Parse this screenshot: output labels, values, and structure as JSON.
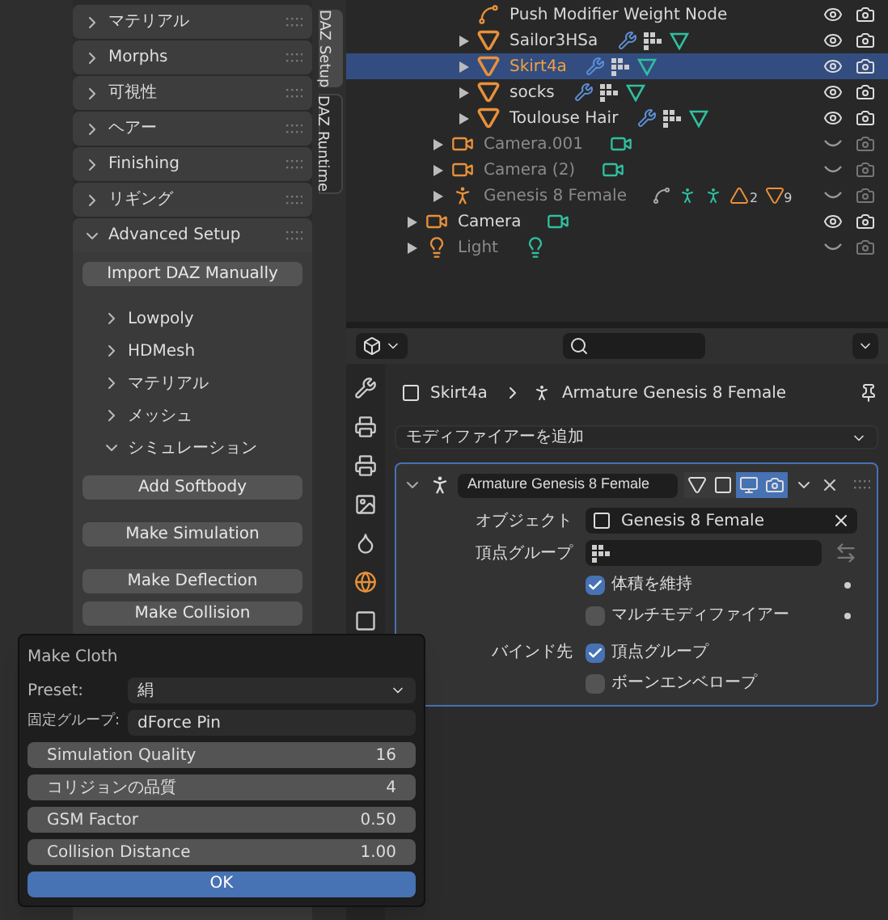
{
  "side_panel": {
    "sections": [
      {
        "label": "マテリアル",
        "expanded": false
      },
      {
        "label": "Morphs",
        "expanded": false
      },
      {
        "label": "可視性",
        "expanded": false
      },
      {
        "label": "ヘアー",
        "expanded": false
      },
      {
        "label": "Finishing",
        "expanded": false
      },
      {
        "label": "リギング",
        "expanded": false
      },
      {
        "label": "Advanced Setup",
        "expanded": true
      }
    ],
    "import_button": "Import DAZ Manually",
    "subsections": [
      {
        "label": "Lowpoly",
        "expanded": false
      },
      {
        "label": "HDMesh",
        "expanded": false
      },
      {
        "label": "マテリアル",
        "expanded": false
      },
      {
        "label": "メッシュ",
        "expanded": false
      },
      {
        "label": "シミュレーション",
        "expanded": true
      }
    ],
    "button_groups": [
      [
        "Add Softbody"
      ],
      [
        "Make Simulation"
      ],
      [
        "Make Deflection",
        "Make Collision"
      ]
    ]
  },
  "tabs": [
    {
      "label": "DAZ Setup",
      "selected": true
    },
    {
      "label": "DAZ Runtime",
      "selected": false
    }
  ],
  "outliner": {
    "items": [
      {
        "children": [
          {
            "children": [
              {
                "name": "Push Modifier Weight Node",
                "kind": "node",
                "selected": false,
                "dimmed": false,
                "visible": true
              },
              {
                "name": "Sailor3HSa",
                "kind": "mesh",
                "selected": false,
                "dimmed": false,
                "visible": true
              },
              {
                "name": "Skirt4a",
                "kind": "mesh",
                "selected": true,
                "dimmed": false,
                "visible": true
              },
              {
                "name": "socks",
                "kind": "mesh",
                "selected": false,
                "dimmed": false,
                "visible": true
              },
              {
                "name": "Toulouse Hair",
                "kind": "mesh",
                "selected": false,
                "dimmed": false,
                "visible": true
              }
            ]
          },
          {
            "name": "Camera.001",
            "kind": "camera",
            "selected": false,
            "dimmed": true,
            "visible": false
          },
          {
            "name": "Camera (2)",
            "kind": "camera",
            "selected": false,
            "dimmed": true,
            "visible": false
          },
          {
            "name": "Genesis 8 Female",
            "kind": "armature",
            "selected": false,
            "dimmed": true,
            "visible": false,
            "counts": [
              "2",
              "9"
            ]
          }
        ]
      },
      {
        "name": "Camera",
        "kind": "camera",
        "selected": false,
        "dimmed": false,
        "visible": true
      },
      {
        "name": "Light",
        "kind": "light",
        "selected": false,
        "dimmed": true,
        "visible": false
      }
    ]
  },
  "properties": {
    "breadcrumb": [
      "Skirt4a",
      "Armature Genesis 8 Female"
    ],
    "add_modifier": "モディファイアーを追加",
    "modifier": {
      "name": "Armature Genesis 8 Female",
      "expanded": true,
      "toggles": [
        {
          "kind": "cage",
          "on": false
        },
        {
          "kind": "editmode",
          "on": false
        },
        {
          "kind": "viewport",
          "on": true
        },
        {
          "kind": "render",
          "on": true
        }
      ],
      "object_label": "オブジェクト",
      "object": "Genesis 8 Female",
      "vertex_group_label": "頂点グループ",
      "options": [
        {
          "label": "体積を維持",
          "checked": true
        },
        {
          "label": "マルチモディファイアー",
          "checked": false
        }
      ],
      "bind_label": "バインド先",
      "bind": [
        {
          "label": "頂点グループ",
          "checked": true
        },
        {
          "label": "ボーンエンベロープ",
          "checked": false
        }
      ]
    }
  },
  "dialog": {
    "title": "Make Cloth",
    "preset_label": "Preset:",
    "preset": "絹",
    "pin_label": "固定グループ:",
    "pin_group": "dForce Pin",
    "fields": [
      {
        "label": "Simulation Quality",
        "value": "16"
      },
      {
        "label": "コリジョンの品質",
        "value": "4"
      },
      {
        "label": "GSM Factor",
        "value": "0.50"
      },
      {
        "label": "Collision Distance",
        "value": "1.00"
      }
    ],
    "ok": "OK"
  }
}
